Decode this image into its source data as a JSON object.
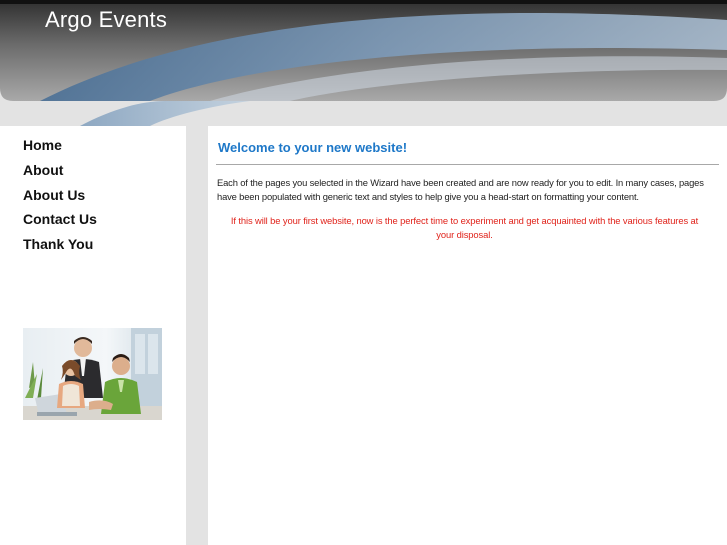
{
  "header": {
    "site_title": "Argo Events"
  },
  "nav": {
    "items": [
      {
        "label": "Home"
      },
      {
        "label": "About"
      },
      {
        "label": "About Us"
      },
      {
        "label": "Contact Us"
      },
      {
        "label": "Thank You"
      }
    ]
  },
  "sidebar": {
    "photo_icon": "office-team-photo"
  },
  "main": {
    "heading": "Welcome to your new website!",
    "paragraph": "Each of the pages you selected in the Wizard have been created and are now ready for you to edit. In many cases, pages have been populated with generic text and styles to help give you a head-start on formatting your content.",
    "note": "If this will be your first website, now is the perfect time to experiment and get acquainted with the various features at your disposal."
  },
  "colors": {
    "heading": "#1e78c8",
    "note": "#e0231b",
    "page_background": "#e3e3e3",
    "banner_dark": "#3d3d3d",
    "banner_swoosh": "#6d8fb0"
  }
}
